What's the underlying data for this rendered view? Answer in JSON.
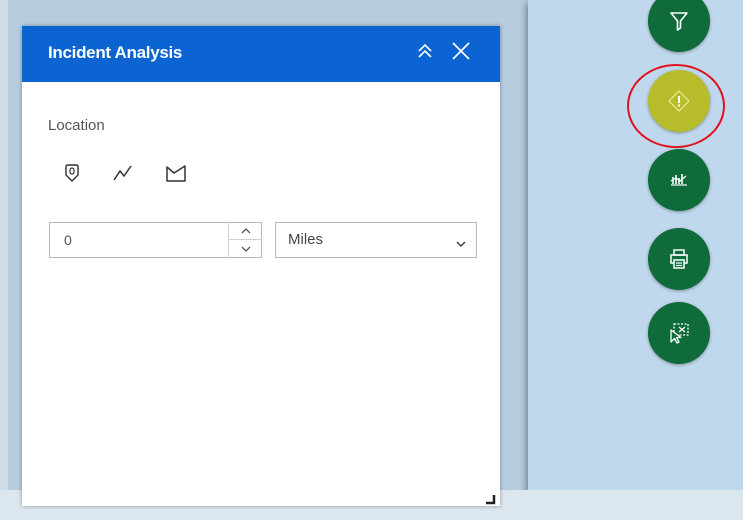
{
  "panel": {
    "title": "Incident Analysis",
    "collapse_icon": "double-chevron-up-icon",
    "close_icon": "close-icon",
    "location_label": "Location",
    "draw_tools": [
      "point-pin-icon",
      "polyline-icon",
      "polygon-icon"
    ],
    "distance": {
      "value": "0",
      "increment_icon": "caret-up-icon",
      "decrement_icon": "caret-down-icon"
    },
    "units": {
      "selected": "Miles",
      "chevron_icon": "chevron-down-icon"
    }
  },
  "toolbar": {
    "buttons": [
      {
        "icon": "filter-icon",
        "active": false
      },
      {
        "icon": "incident-analysis-icon",
        "active": true
      },
      {
        "icon": "chart-icon",
        "active": false
      },
      {
        "icon": "print-icon",
        "active": false
      },
      {
        "icon": "select-icon",
        "active": false
      }
    ]
  },
  "colors": {
    "header": "#0b64d2",
    "tool_button": "#0f6b3a",
    "active_tool_button": "#b7bc2b",
    "highlight_ring": "#e0141e",
    "map_background": "#c0d8ee"
  }
}
